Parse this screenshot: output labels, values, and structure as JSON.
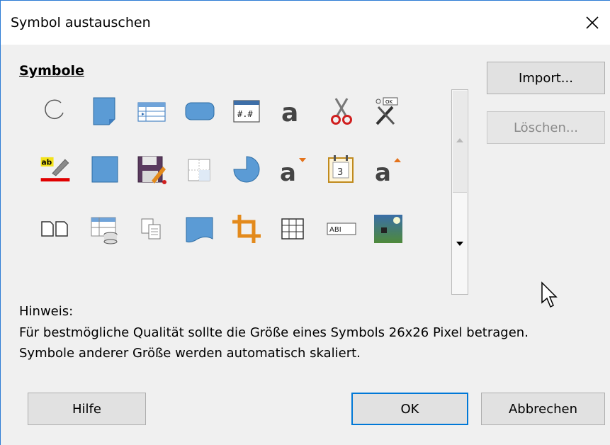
{
  "window": {
    "title": "Symbol austauschen",
    "close_label": "✕"
  },
  "symbols_heading": "Symbole",
  "symbols": [
    [
      "arc-icon",
      "page-icon",
      "form-table-icon",
      "rounded-rect-icon",
      "number-field-icon",
      "fontwork-a-icon",
      "cut-icon",
      "customize-tools-icon"
    ],
    [
      "highlight-pen-icon",
      "square-icon",
      "save-edit-icon",
      "table-split-icon",
      "pie-icon",
      "grow-font-icon",
      "calendar-date-icon",
      "shrink-font-icon"
    ],
    [
      "two-pages-icon",
      "database-table-icon",
      "copy-icon",
      "flowchart-doc-icon",
      "crop-icon",
      "table-grid-icon",
      "text-field-icon",
      "image-icon"
    ]
  ],
  "buttons": {
    "import": "Import...",
    "delete": "Löschen...",
    "help": "Hilfe",
    "ok": "OK",
    "cancel": "Abbrechen"
  },
  "hint": {
    "label": "Hinweis:",
    "line1": "Für bestmögliche Qualität sollte die Größe eines Symbols 26x26 Pixel betragen.",
    "line2": "Symbole anderer Größe werden automatisch skaliert."
  }
}
